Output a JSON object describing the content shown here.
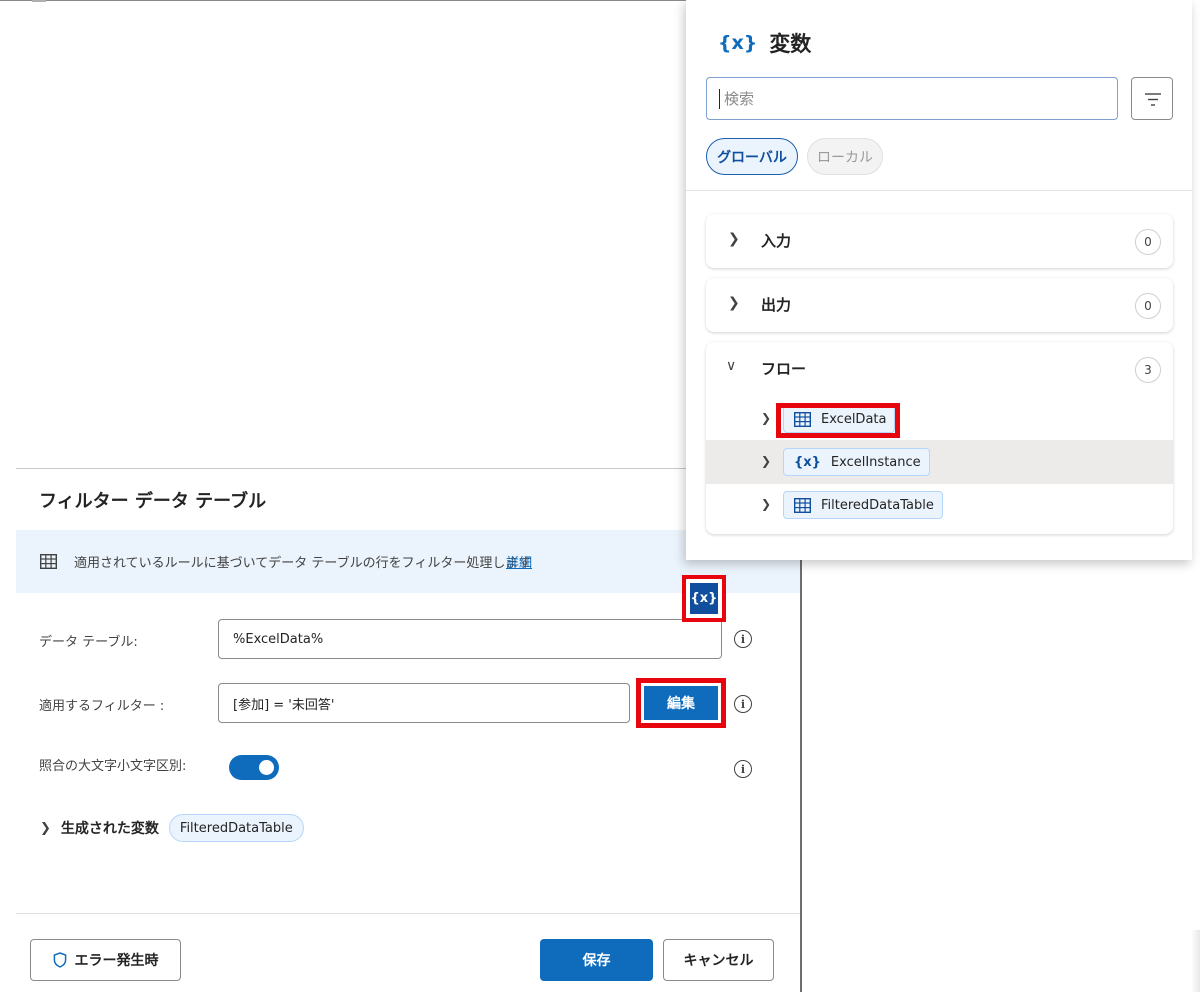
{
  "variables_panel": {
    "title_icon": "{x}",
    "title": "変数",
    "search_placeholder": "検索",
    "filter_icon": "filter-icon",
    "chips": {
      "global": "グローバル",
      "local": "ローカル"
    },
    "sections": [
      {
        "label": "入力",
        "count": "0",
        "expanded": false
      },
      {
        "label": "出力",
        "count": "0",
        "expanded": false
      },
      {
        "label": "フロー",
        "count": "3",
        "expanded": true
      }
    ],
    "flow_variables": [
      {
        "name": "ExcelData",
        "icon": "table-icon"
      },
      {
        "name": "ExcelInstance",
        "icon": "variable-icon"
      },
      {
        "name": "FilteredDataTable",
        "icon": "table-icon"
      }
    ]
  },
  "dialog": {
    "title": "フィルター データ テーブル",
    "info_text": "適用されているルールに基づいてデータ テーブルの行をフィルター処理します",
    "info_link": "詳細",
    "var_button": "{x}",
    "fields": {
      "data_table_label": "データ テーブル:",
      "data_table_value": "%ExcelData%",
      "filter_label": "適用するフィルター :",
      "filter_value": "[参加] = '未回答'",
      "edit_button": "編集",
      "case_label": "照合の大文字小文字区別:",
      "case_enabled": true
    },
    "generated_label": "生成された変数",
    "generated_var": "FilteredDataTable",
    "footer": {
      "error_button": "エラー発生時",
      "save_button": "保存",
      "cancel_button": "キャンセル"
    }
  },
  "colors": {
    "accent": "#0f6cbd",
    "highlight": "#e8060e",
    "info_bg": "#ebf3fc"
  }
}
